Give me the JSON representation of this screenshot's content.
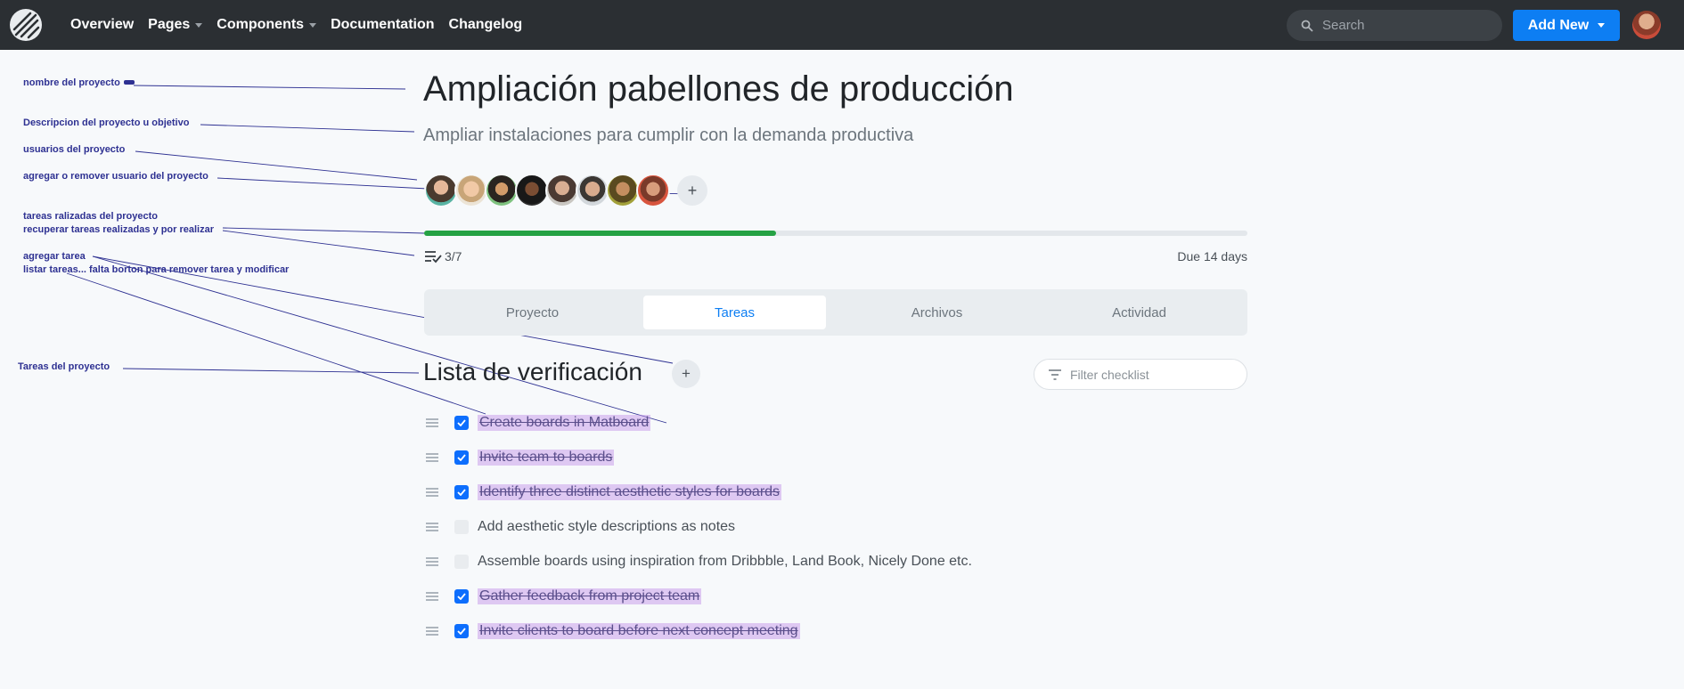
{
  "nav": {
    "items": [
      {
        "label": "Overview",
        "dropdown": false
      },
      {
        "label": "Pages",
        "dropdown": true
      },
      {
        "label": "Components",
        "dropdown": true
      },
      {
        "label": "Documentation",
        "dropdown": false
      },
      {
        "label": "Changelog",
        "dropdown": false
      }
    ],
    "search_placeholder": "Search",
    "add_new_label": "Add New"
  },
  "project": {
    "title": "Ampliación pabellones de producción",
    "description": "Ampliar instalaciones para cumplir con la demanda productiva",
    "progress_fraction": 0.428,
    "progress_color": "#25a244",
    "task_count": "3/7",
    "due": "Due 14 days"
  },
  "tabs": [
    {
      "label": "Proyecto",
      "active": false
    },
    {
      "label": "Tareas",
      "active": true
    },
    {
      "label": "Archivos",
      "active": false
    },
    {
      "label": "Actividad",
      "active": false
    }
  ],
  "checklist": {
    "title": "Lista de verificación",
    "filter_placeholder": "Filter checklist",
    "tasks": [
      {
        "label": "Create boards in Matboard",
        "done": true
      },
      {
        "label": "Invite team to boards",
        "done": true
      },
      {
        "label": "Identify three distinct aesthetic styles for boards",
        "done": true
      },
      {
        "label": "Add aesthetic style descriptions as notes",
        "done": false
      },
      {
        "label": "Assemble boards using inspiration from Dribbble, Land Book, Nicely Done etc.",
        "done": false
      },
      {
        "label": "Gather feedback from project team",
        "done": true
      },
      {
        "label": "Invite clients to board before next concept meeting",
        "done": true
      }
    ]
  },
  "annotations": [
    "nombre del proyecto",
    "Descripcion del proyecto u objetivo",
    "usuarios del proyecto",
    "agregar o remover usuario del proyecto",
    "tareas ralizadas del proyecto",
    "recuperar tareas realizadas y por realizar",
    "agregar tarea",
    "listar tareas... falta borton para remover tarea y modificar",
    "Tareas del proyecto"
  ],
  "colors": {
    "accent": "#0d7ef3",
    "annotation": "#2e3192",
    "checkbox": "#0d6efd"
  },
  "icons": [
    "logo-icon",
    "search-icon",
    "avatar",
    "checklist-icon",
    "filter-icon",
    "drag-handle-icon",
    "check-icon",
    "plus-icon"
  ]
}
